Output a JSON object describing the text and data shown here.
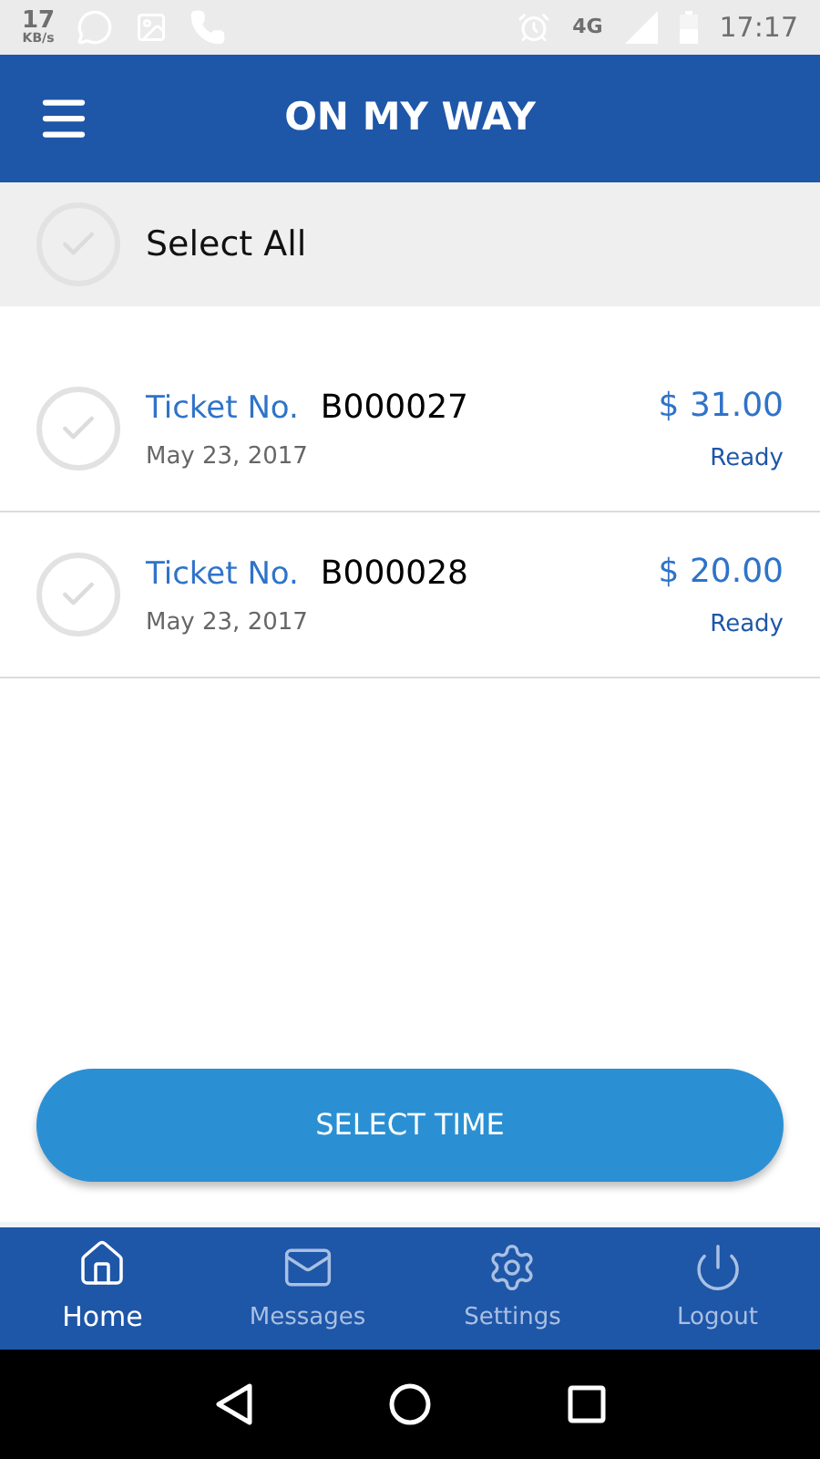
{
  "status_bar": {
    "speed": "17",
    "speed_unit": "KB/s",
    "network": "4G",
    "time": "17:17"
  },
  "header": {
    "title": "ON MY WAY"
  },
  "select_all": {
    "label": "Select All",
    "checked": false
  },
  "tickets": [
    {
      "label": "Ticket No.",
      "number": "B000027",
      "date": "May 23, 2017",
      "price": "$ 31.00",
      "status": "Ready",
      "checked": false
    },
    {
      "label": "Ticket No.",
      "number": "B000028",
      "date": "May 23, 2017",
      "price": "$ 20.00",
      "status": "Ready",
      "checked": false
    }
  ],
  "action_button": "SELECT TIME",
  "bottom_nav": [
    {
      "label": "Home",
      "selected": true
    },
    {
      "label": "Messages",
      "selected": false
    },
    {
      "label": "Settings",
      "selected": false
    },
    {
      "label": "Logout",
      "selected": false
    }
  ]
}
